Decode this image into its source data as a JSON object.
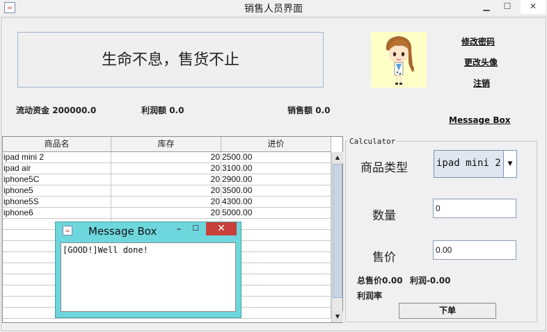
{
  "window": {
    "title": "销售人员界面"
  },
  "slogan": "生命不息，售货不止",
  "links": {
    "change_password": "修改密码",
    "change_avatar": "更改头像",
    "logout": "注销",
    "message_box": "Message Box"
  },
  "stats": {
    "funds_label": "流动资金",
    "funds_value": "200000.0",
    "profit_label": "利润额",
    "profit_value": "0.0",
    "sales_label": "销售额",
    "sales_value": "0.0"
  },
  "table": {
    "headers": [
      "商品名",
      "库存",
      "进价"
    ],
    "rows": [
      [
        "ipad mini 2",
        "20",
        "2500.00"
      ],
      [
        "ipad air",
        "20",
        "3100.00"
      ],
      [
        "iphone5C",
        "20",
        "2900.00"
      ],
      [
        "iphone5",
        "20",
        "3500.00"
      ],
      [
        "iphone5S",
        "20",
        "4300.00"
      ],
      [
        "iphone6",
        "20",
        "5000.00"
      ]
    ]
  },
  "calculator": {
    "title": "Calculator",
    "type_label": "商品类型",
    "type_value": "ipad mini 2",
    "quantity_label": "数量",
    "quantity_value": "0",
    "price_label": "售价",
    "price_value": "0.00",
    "total_label": "总售价",
    "total_value": "0.00",
    "profit_label": "利润",
    "profit_value": "-0.00",
    "rate_label": "利润率",
    "order_button": "下单"
  },
  "dialog": {
    "title": "Message Box",
    "message": "[GOOD!]Well done!"
  },
  "colors": {
    "dialog_bg": "#6ed6dd",
    "close_red": "#c8403a",
    "avatar_bg": "#ffffc8",
    "scroll_thumb": "#c9d5e6"
  }
}
